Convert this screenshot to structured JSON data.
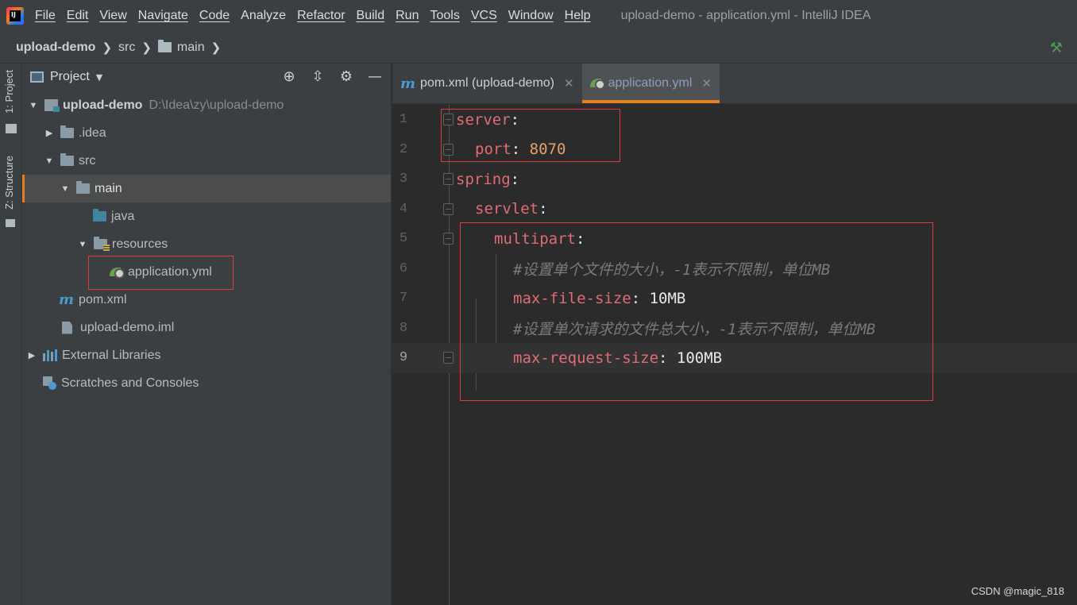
{
  "menubar": {
    "items": [
      "File",
      "Edit",
      "View",
      "Navigate",
      "Code",
      "Analyze",
      "Refactor",
      "Build",
      "Run",
      "Tools",
      "VCS",
      "Window",
      "Help"
    ],
    "window_title": "upload-demo - application.yml - IntelliJ IDEA"
  },
  "breadcrumb": [
    "upload-demo",
    "src",
    "main"
  ],
  "toolstrip": {
    "project_tab": "1: Project",
    "structure_tab": "Z: Structure"
  },
  "project_panel": {
    "title": "Project",
    "tree": [
      {
        "label": "upload-demo",
        "path": "D:\\Idea\\zy\\upload-demo",
        "icon": "module-icon",
        "expanded": true
      },
      {
        "label": ".idea",
        "icon": "folder-icon",
        "expanded": false
      },
      {
        "label": "src",
        "icon": "folder-icon",
        "expanded": true
      },
      {
        "label": "main",
        "icon": "folder-icon",
        "expanded": true,
        "selected": true
      },
      {
        "label": "java",
        "icon": "source-folder-icon"
      },
      {
        "label": "resources",
        "icon": "resources-folder-icon",
        "expanded": true
      },
      {
        "label": "application.yml",
        "icon": "spring-config-icon"
      },
      {
        "label": "pom.xml",
        "icon": "maven-icon"
      },
      {
        "label": "upload-demo.iml",
        "icon": "iml-file-icon"
      },
      {
        "label": "External Libraries",
        "icon": "library-icon",
        "expanded": false
      },
      {
        "label": "Scratches and Consoles",
        "icon": "scratches-icon"
      }
    ]
  },
  "editor": {
    "tabs": [
      {
        "label": "pom.xml (upload-demo)",
        "active": false
      },
      {
        "label": "application.yml",
        "active": true
      }
    ],
    "lines": [
      {
        "n": "1",
        "key": "server",
        "sep": ":",
        "value": ""
      },
      {
        "n": "2",
        "key": "port",
        "sep": ": ",
        "value": "8070"
      },
      {
        "n": "3",
        "key": "spring",
        "sep": ":",
        "value": ""
      },
      {
        "n": "4",
        "key": "servlet",
        "sep": ":",
        "value": ""
      },
      {
        "n": "5",
        "key": "multipart",
        "sep": ":",
        "value": ""
      },
      {
        "n": "6",
        "comment": "#设置单个文件的大小，-1表示不限制，单位MB"
      },
      {
        "n": "7",
        "key": "max-file-size",
        "sep": ": ",
        "value": "10MB"
      },
      {
        "n": "8",
        "comment": "#设置单次请求的文件总大小，-1表示不限制，单位MB"
      },
      {
        "n": "9",
        "key": "max-request-size",
        "sep": ": ",
        "value": "100MB"
      }
    ]
  },
  "watermark": "CSDN @magic_818",
  "colors": {
    "accent": "#e67e22",
    "highlight_box": "#e03a3a",
    "yaml_key": "#e06c75",
    "yaml_number": "#e5a16b"
  }
}
